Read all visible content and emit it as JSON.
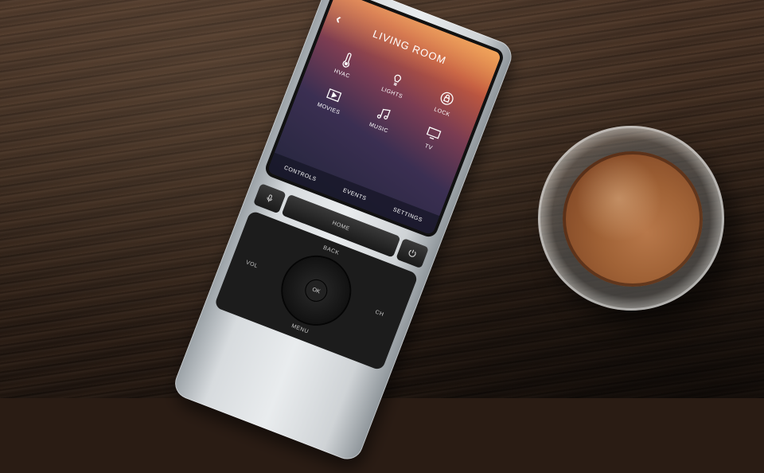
{
  "scene": {
    "remote": {
      "screen": {
        "back_glyph": "‹",
        "title": "LIVING ROOM",
        "tiles": [
          {
            "label": "HVAC",
            "icon": "thermometer-icon"
          },
          {
            "label": "LIGHTS",
            "icon": "lightbulb-icon"
          },
          {
            "label": "LOCK",
            "icon": "lock-icon"
          },
          {
            "label": "MOVIES",
            "icon": "movie-icon"
          },
          {
            "label": "MUSIC",
            "icon": "music-note-icon"
          },
          {
            "label": "TV",
            "icon": "tv-icon"
          }
        ],
        "tabs": [
          "CONTROLS",
          "EVENTS",
          "SETTINGS"
        ]
      },
      "buttons": {
        "voice_icon": "microphone-icon",
        "home": "HOME",
        "power_icon": "power-icon",
        "back": "BACK",
        "vol": "VOL",
        "ch": "CH",
        "ok": "OK",
        "menu": "MENU"
      }
    },
    "colors": {
      "table": "#3b291d",
      "coffee": "#a06236",
      "remote": "#d7dbde"
    }
  }
}
